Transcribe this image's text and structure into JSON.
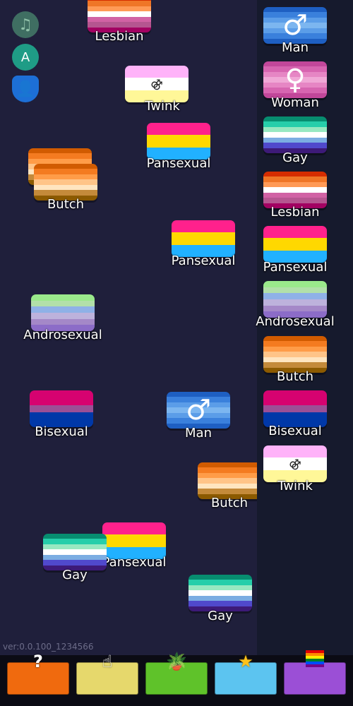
{
  "flag_styles": {
    "lesbian": [
      "#d52d00",
      "#ef7627",
      "#ff9a56",
      "#ffffff",
      "#d162a4",
      "#b55690",
      "#a30262"
    ],
    "man": [
      "#1e5fc2",
      "#3a80dc",
      "#5b9de8",
      "#7cb6f0",
      "#5b9de8",
      "#3a80dc",
      "#1e5fc2"
    ],
    "woman": [
      "#c2479a",
      "#d765b0",
      "#e686c4",
      "#f0a8d6",
      "#e686c4",
      "#d765b0",
      "#c2479a"
    ],
    "gay": [
      "#078d70",
      "#26ceaa",
      "#98e8c1",
      "#ffffff",
      "#7bade2",
      "#5049cc",
      "#3d1a78"
    ],
    "pansexual": [
      "#ff218c",
      "#ffd800",
      "#21b1ff"
    ],
    "androsexual": [
      "#9ae98b",
      "#b2e0a9",
      "#8fb1e7",
      "#bdb2dc",
      "#a488c8",
      "#8c6cc8"
    ],
    "butch": [
      "#d15b00",
      "#f47b20",
      "#ff9c48",
      "#ffc488",
      "#ffe5c0",
      "#c48a3a",
      "#8c5a00"
    ],
    "bisexual": [
      "#d60270",
      "#d60270",
      "#9b4f96",
      "#0038a8",
      "#0038a8"
    ],
    "twink": [
      "#ffb3f9",
      "#ffffff",
      "#fff798"
    ]
  },
  "symbols": {
    "man": "♂",
    "woman": "♀",
    "twink": "⚣"
  },
  "board_tiles": [
    {
      "type": "lesbian",
      "label": "Lesbian"
    },
    {
      "type": "twink",
      "label": "Twink"
    },
    {
      "type": "pansexual",
      "label": "Pansexual"
    },
    {
      "type": "butch",
      "label": ""
    },
    {
      "type": "butch",
      "label": "Butch"
    },
    {
      "type": "pansexual",
      "label": "Pansexual"
    },
    {
      "type": "androsexual",
      "label": "Androsexual"
    },
    {
      "type": "bisexual",
      "label": "Bisexual"
    },
    {
      "type": "man",
      "label": "Man"
    },
    {
      "type": "butch",
      "label": "Butch"
    },
    {
      "type": "pansexual",
      "label": "Pansexual"
    },
    {
      "type": "gay",
      "label": "Gay"
    },
    {
      "type": "gay",
      "label": "Gay"
    }
  ],
  "sidebar_tiles": [
    {
      "type": "man",
      "label": "Man"
    },
    {
      "type": "woman",
      "label": "Woman"
    },
    {
      "type": "gay",
      "label": "Gay"
    },
    {
      "type": "lesbian",
      "label": "Lesbian"
    },
    {
      "type": "pansexual",
      "label": "Pansexual"
    },
    {
      "type": "androsexual",
      "label": "Androsexual"
    },
    {
      "type": "butch",
      "label": "Butch"
    },
    {
      "type": "bisexual",
      "label": "Bisexual"
    },
    {
      "type": "twink",
      "label": "Twink"
    }
  ],
  "side_buttons": [
    {
      "name": "music-note-icon",
      "glyph": "♫",
      "bg": "#3f6e62",
      "fg": "#8fc0a8"
    },
    {
      "name": "globe-language-icon",
      "glyph": "A",
      "bg": "#1f9c86",
      "fg": "#ffffff"
    },
    {
      "name": "shield-user-icon",
      "glyph": "👤",
      "bg": "#1d6fd6",
      "fg": "#ffffff"
    }
  ],
  "version": "ver:0.0.100_1234566",
  "bottom_tabs": [
    {
      "name": "help-tab",
      "icon_name": "question-icon",
      "glyph": "?",
      "color": "#f06a0e"
    },
    {
      "name": "hand-tab",
      "icon_name": "pointer-hand-icon",
      "glyph": "☝",
      "color": "#e6d86c"
    },
    {
      "name": "plant-tab",
      "icon_name": "potted-plant-icon",
      "glyph": "🪴",
      "color": "#5fc22a"
    },
    {
      "name": "star-tab",
      "icon_name": "star-icon",
      "glyph": "★",
      "color": "#5cc4f0"
    },
    {
      "name": "pride-tab",
      "icon_name": "rainbow-flag-icon",
      "glyph": "",
      "color": "#9b4fd6"
    }
  ]
}
